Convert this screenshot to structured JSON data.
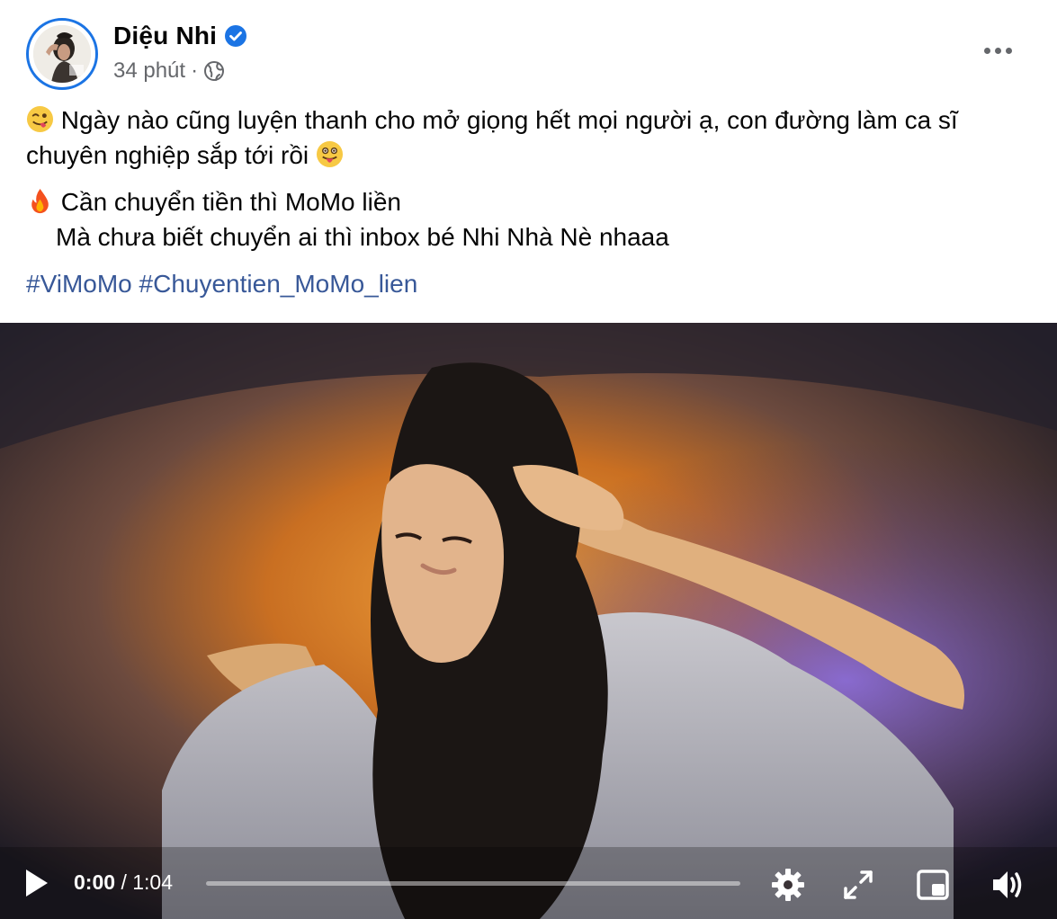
{
  "post": {
    "author": "Diệu Nhi",
    "time": "34 phút",
    "separator": "·",
    "audience_icon": "globe-icon",
    "verified_color": "#1b74e4",
    "line1_text": "Ngày nào cũng luyện thanh cho mở giọng hết mọi người ạ, con đường làm ca sĩ chuyên nghiệp sắp tới rồi",
    "line2_text": "Cần chuyển tiền thì MoMo liền",
    "line3_text": "Mà chưa biết chuyển ai thì inbox bé Nhi Nhà Nè nhaaa",
    "hashtags": [
      "#ViMoMo",
      "#Chuyentien_MoMo_lien"
    ],
    "hashtag_color": "#385898"
  },
  "video": {
    "current_time": "0:00",
    "time_separator": "/",
    "duration": "1:04",
    "progress": 0,
    "controls": [
      "play-icon",
      "gear-icon",
      "fullscreen-icon",
      "picture-in-picture-icon",
      "volume-icon"
    ]
  }
}
